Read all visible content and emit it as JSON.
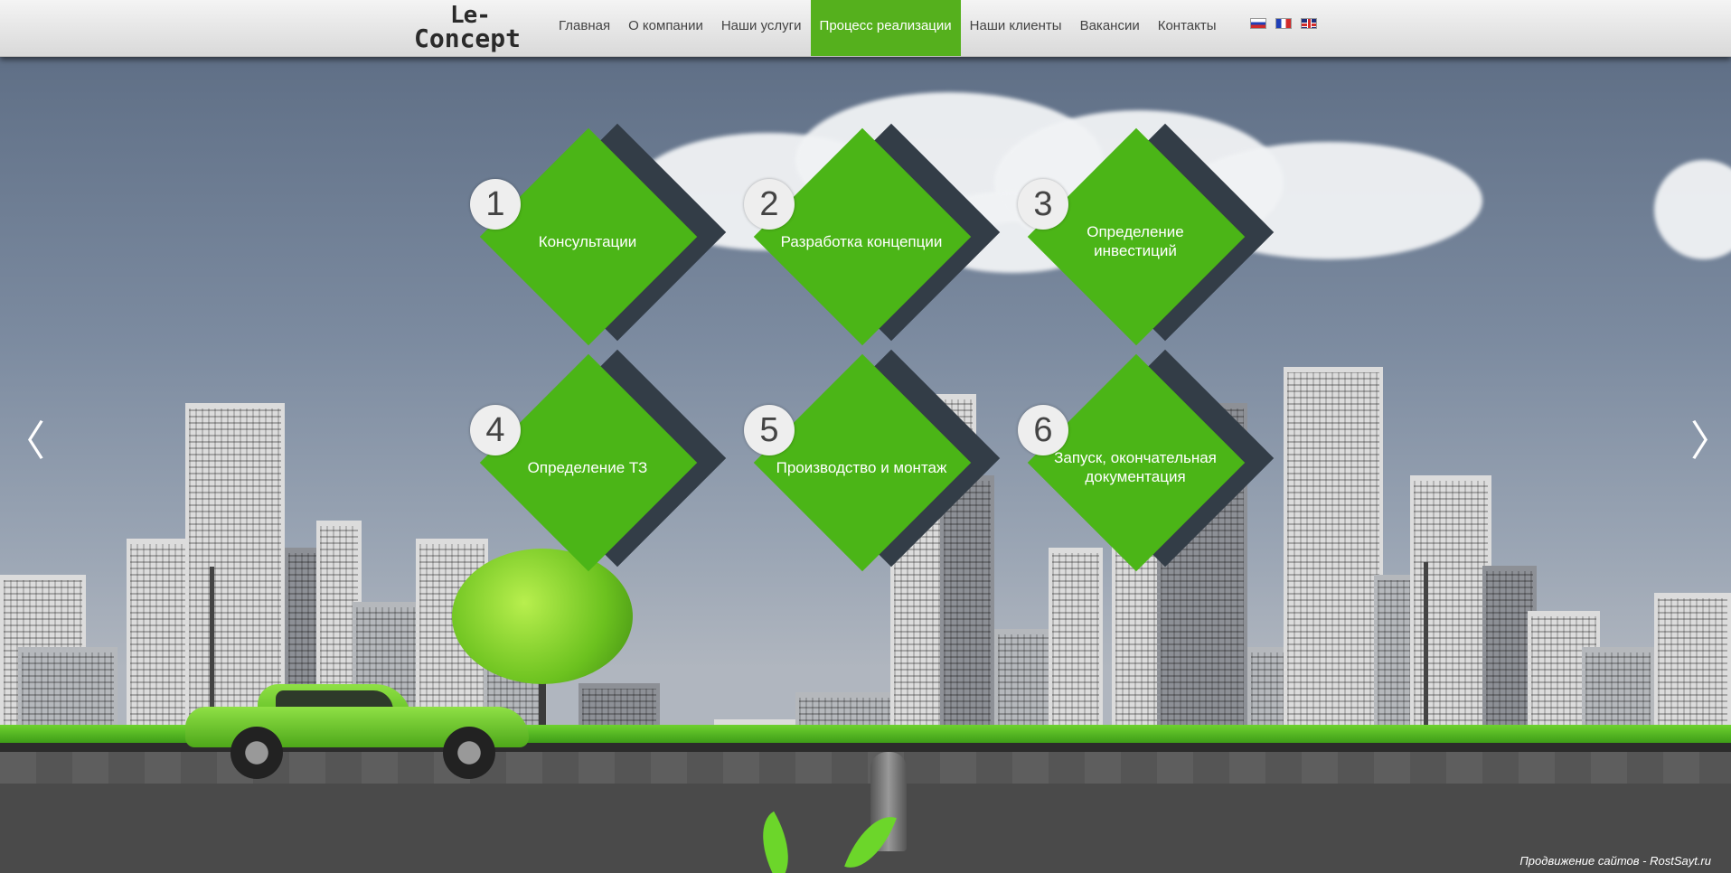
{
  "brand": {
    "line1": "Le-",
    "line2": "Concept"
  },
  "nav": {
    "items": [
      {
        "label": "Главная"
      },
      {
        "label": "О компании"
      },
      {
        "label": "Наши услуги"
      },
      {
        "label": "Процесс реализации"
      },
      {
        "label": "Наши клиенты"
      },
      {
        "label": "Вакансии"
      },
      {
        "label": "Контакты"
      }
    ],
    "active_index": 3,
    "active_color": "#55b01d"
  },
  "languages": [
    "ru-flag",
    "fr-flag",
    "en-flag"
  ],
  "steps": [
    {
      "number": "1",
      "label": "Консультации"
    },
    {
      "number": "2",
      "label": "Разработка концепции"
    },
    {
      "number": "3",
      "label": "Определение инвестиций"
    },
    {
      "number": "4",
      "label": "Определение ТЗ"
    },
    {
      "number": "5",
      "label": "Производство и монтаж"
    },
    {
      "number": "6",
      "label": "Запуск, окончательная документация"
    }
  ],
  "slider": {
    "prev_glyph": "〈",
    "next_glyph": "〉"
  },
  "footer": {
    "credit": "Продвижение сайтов - RostSayt.ru"
  },
  "colors": {
    "accent": "#4bb517",
    "shadow": "#333d47"
  }
}
